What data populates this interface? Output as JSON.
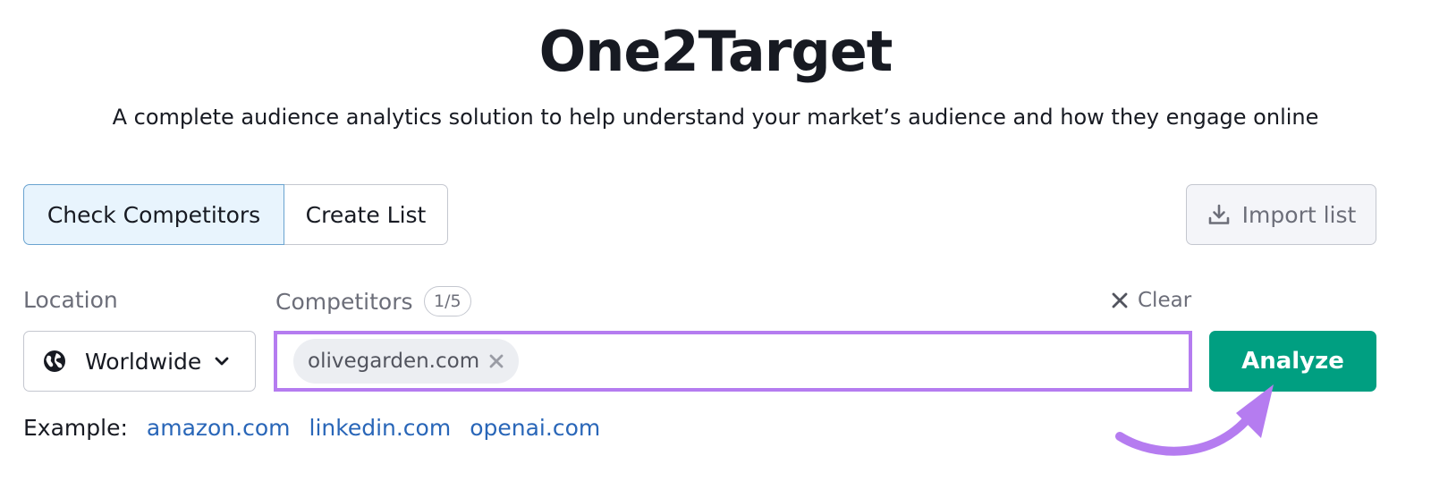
{
  "header": {
    "title": "One2Target",
    "subtitle": "A complete audience analytics solution to help understand your market’s audience and how they engage online"
  },
  "tabs": [
    {
      "label": "Check Competitors",
      "active": true
    },
    {
      "label": "Create List",
      "active": false
    }
  ],
  "import": {
    "label": "Import list",
    "icon": "download-icon"
  },
  "location": {
    "label": "Location",
    "selected": "Worldwide",
    "icon": "globe-icon"
  },
  "competitors": {
    "label": "Competitors",
    "count": "1/5",
    "clear_label": "Clear",
    "chips": [
      "olivegarden.com"
    ]
  },
  "analyze": {
    "label": "Analyze"
  },
  "examples": {
    "label": "Example:",
    "links": [
      "amazon.com",
      "linkedin.com",
      "openai.com"
    ]
  },
  "colors": {
    "accent_green": "#009f81",
    "highlight_purple": "#b57cf0",
    "link_blue": "#2966b8",
    "active_tab_bg": "#e8f4fd"
  }
}
